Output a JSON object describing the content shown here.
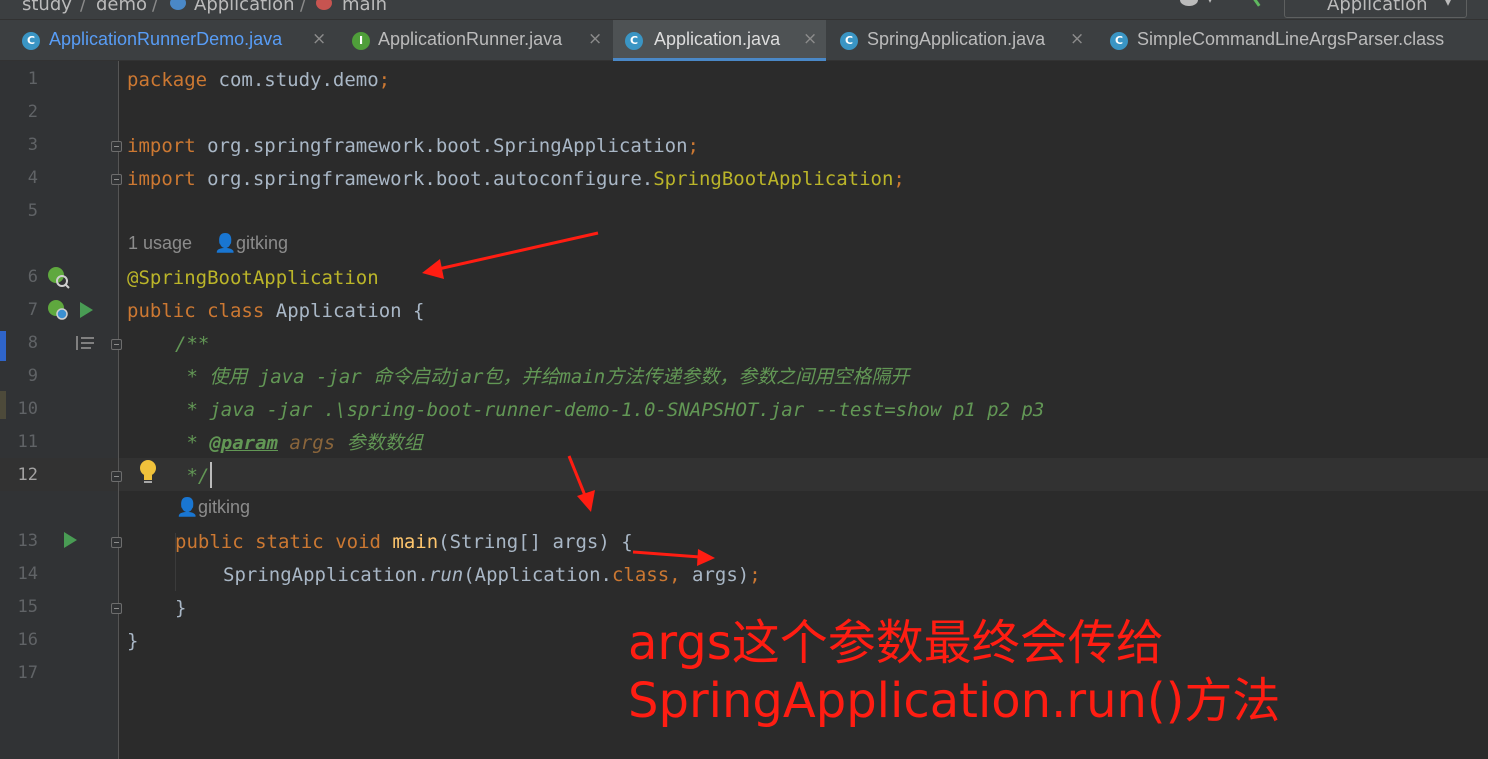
{
  "breadcrumb": {
    "items": [
      "study",
      "demo",
      "Application",
      "main"
    ]
  },
  "run_config": {
    "label": "Application"
  },
  "tabs": [
    {
      "label": "ApplicationRunnerDemo.java",
      "icon": "class-icon",
      "active": false,
      "color": "#589df6"
    },
    {
      "label": "ApplicationRunner.java",
      "icon": "interface-icon",
      "active": false,
      "color": "#bbbbbb"
    },
    {
      "label": "Application.java",
      "icon": "spring-class-icon",
      "active": true,
      "color": "#dddddd"
    },
    {
      "label": "SpringApplication.java",
      "icon": "class-icon",
      "active": false,
      "color": "#bbbbbb"
    },
    {
      "label": "SimpleCommandLineArgsParser.class",
      "icon": "class-icon",
      "active": false,
      "color": "#bbbbbb"
    }
  ],
  "editor": {
    "line_numbers": [
      "1",
      "2",
      "3",
      "4",
      "5",
      "6",
      "7",
      "8",
      "9",
      "10",
      "11",
      "12",
      "13",
      "14",
      "15",
      "16",
      "17"
    ],
    "current_line": "12",
    "hints": {
      "usage": "1 usage",
      "author_class": "gitking",
      "author_method": "gitking"
    },
    "code": {
      "l1": {
        "kw": "package",
        "rest": " com.study.demo",
        "semi": ";"
      },
      "l3": {
        "kw": "import",
        "rest": " org.springframework.boot.SpringApplication",
        "semi": ";"
      },
      "l4": {
        "kw": "import",
        "rest": " org.springframework.boot.autoconfigure.",
        "cls": "SpringBootApplication",
        "semi": ";"
      },
      "l6": {
        "annotation": "@SpringBootApplication"
      },
      "l7": {
        "kw1": "public",
        "kw2": "class",
        "name": "Application",
        "brace": " {"
      },
      "l8": {
        "doc": "/**"
      },
      "l9": {
        "doc": " * 使用 java -jar 命令启动jar包，并给main方法传递参数，参数之间用空格隔开"
      },
      "l10": {
        "doc": " * java -jar .\\spring-boot-runner-demo-1.0-SNAPSHOT.jar --test=show p1 p2 p3"
      },
      "l11": {
        "star": " * ",
        "tag": "@param",
        "param": " args",
        "desc": " 参数数组"
      },
      "l12": {
        "doc": " */"
      },
      "l13": {
        "kw1": "public",
        "kw2": "static",
        "kw3": "void",
        "method": "main",
        "sig": "(String[] args) {"
      },
      "l14": {
        "cls": "SpringApplication.",
        "call": "run",
        "open": "(Application.",
        "kw": "class",
        "comma": ",",
        "rest": " args)",
        "semi": ";"
      },
      "l15": {
        "brace": "}"
      },
      "l16": {
        "brace": "}"
      }
    }
  },
  "annotation": {
    "line1": "args这个参数最终会传给",
    "line2": "SpringApplication.run()方法",
    "color": "#ff1d12"
  }
}
